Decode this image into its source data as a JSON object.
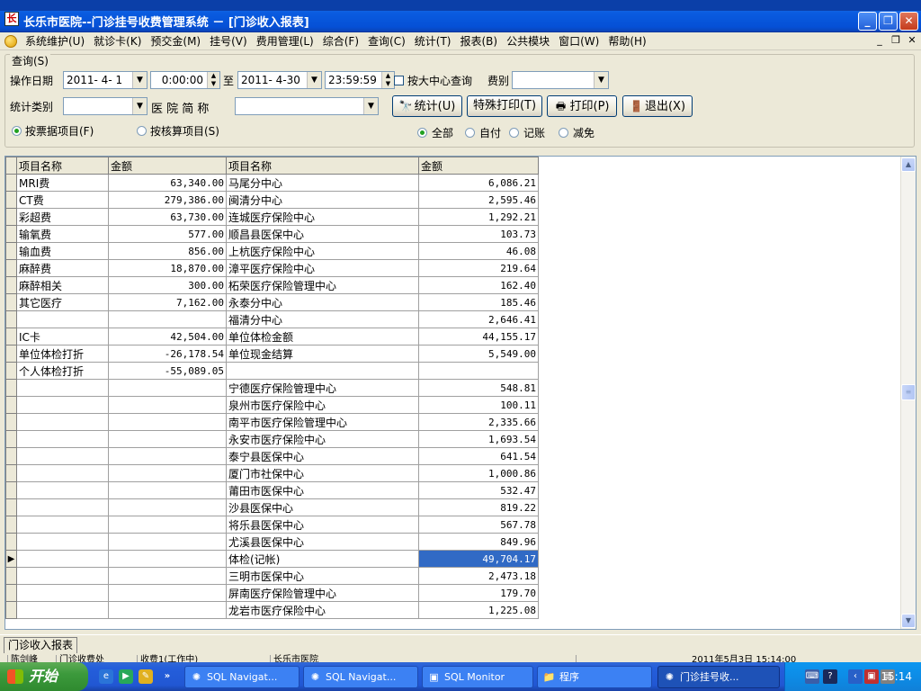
{
  "window": {
    "title": "长乐市医院--门诊挂号收费管理系统 － [门诊收入报表]",
    "app_icon": "hospital-app-icon",
    "buttons": {
      "minimize": "_",
      "restore": "❐",
      "close": "✕"
    }
  },
  "menu": [
    "系统维护(U)",
    "就诊卡(K)",
    "预交金(M)",
    "挂号(V)",
    "费用管理(L)",
    "综合(F)",
    "查询(C)",
    "统计(T)",
    "报表(B)",
    "公共模块",
    "窗口(W)",
    "帮助(H)"
  ],
  "mdi_buttons": {
    "minimize": "_",
    "restore": "❐",
    "close": "✕"
  },
  "query": {
    "group_title": "查询(S)",
    "date_label": "操作日期",
    "start_date": "2011- 4- 1",
    "start_time": "0:00:00",
    "to_label": "至",
    "end_date": "2011- 4-30",
    "end_time": "23:59:59",
    "center_checkbox_label": "按大中心查询",
    "fee_type_label": "费别",
    "fee_type_value": "",
    "stat_type_label": "统计类别",
    "stat_type_value": "",
    "hospital_label": "医 院 简 称",
    "hospital_value": "",
    "radio_invoice": "按票据项目(F)",
    "radio_accounting": "按核算项目(S)",
    "filter_all": "全部",
    "filter_self": "自付",
    "filter_account": "记账",
    "filter_waive": "减免"
  },
  "buttons": {
    "stat": "统计(U)",
    "special_print": "特殊打印(T)",
    "print": "打印(P)",
    "exit": "退出(X)"
  },
  "grid": {
    "headers": [
      "项目名称",
      "金额",
      "项目名称",
      "金额"
    ],
    "rows": [
      {
        "a": "MRI费",
        "b": "63,340.00",
        "c": "马尾分中心",
        "d": "6,086.21"
      },
      {
        "a": "CT费",
        "b": "279,386.00",
        "c": "闽清分中心",
        "d": "2,595.46"
      },
      {
        "a": "彩超费",
        "b": "63,730.00",
        "c": "连城医疗保险中心",
        "d": "1,292.21"
      },
      {
        "a": "输氧费",
        "b": "577.00",
        "c": "顺昌县医保中心",
        "d": "103.73"
      },
      {
        "a": "输血费",
        "b": "856.00",
        "c": "上杭医疗保险中心",
        "d": "46.08"
      },
      {
        "a": "麻醉费",
        "b": "18,870.00",
        "c": "漳平医疗保险中心",
        "d": "219.64"
      },
      {
        "a": "麻醉相关",
        "b": "300.00",
        "c": "柘荣医疗保险管理中心",
        "d": "162.40"
      },
      {
        "a": "其它医疗",
        "b": "7,162.00",
        "c": "永泰分中心",
        "d": "185.46"
      },
      {
        "a": "",
        "b": "",
        "c": "福清分中心",
        "d": "2,646.41"
      },
      {
        "a": "IC卡",
        "b": "42,504.00",
        "c": "单位体检金额",
        "d": "44,155.17"
      },
      {
        "a": "单位体检打折",
        "b": "-26,178.54",
        "c": "单位现金结算",
        "d": "5,549.00"
      },
      {
        "a": "个人体检打折",
        "b": "-55,089.05",
        "c": "",
        "d": ""
      },
      {
        "a": "",
        "b": "",
        "c": "宁德医疗保险管理中心",
        "d": "548.81"
      },
      {
        "a": "",
        "b": "",
        "c": "泉州市医疗保险中心",
        "d": "100.11"
      },
      {
        "a": "",
        "b": "",
        "c": "南平市医疗保险管理中心",
        "d": "2,335.66"
      },
      {
        "a": "",
        "b": "",
        "c": "永安市医疗保险中心",
        "d": "1,693.54"
      },
      {
        "a": "",
        "b": "",
        "c": "泰宁县医保中心",
        "d": "641.54"
      },
      {
        "a": "",
        "b": "",
        "c": "厦门市社保中心",
        "d": "1,000.86"
      },
      {
        "a": "",
        "b": "",
        "c": "莆田市医保中心",
        "d": "532.47"
      },
      {
        "a": "",
        "b": "",
        "c": "沙县医保中心",
        "d": "819.22"
      },
      {
        "a": "",
        "b": "",
        "c": "将乐县医保中心",
        "d": "567.78"
      },
      {
        "a": "",
        "b": "",
        "c": "尤溪县医保中心",
        "d": "849.96"
      },
      {
        "a": "",
        "b": "",
        "c": "体检(记帐)",
        "d": "49,704.17",
        "selected": true
      },
      {
        "a": "",
        "b": "",
        "c": "三明市医保中心",
        "d": "2,473.18"
      },
      {
        "a": "",
        "b": "",
        "c": "屏南医疗保险管理中心",
        "d": "179.70"
      },
      {
        "a": "",
        "b": "",
        "c": "龙岩市医疗保险中心",
        "d": "1,225.08"
      }
    ]
  },
  "tab": "门诊收入报表",
  "status": [
    "陈剑峰",
    "门诊收费处",
    "收费1(工作中)",
    "长乐市医院",
    "2011年5月3日 15:14:00"
  ],
  "taskbar": {
    "start": "开始",
    "tasks": [
      {
        "label": "SQL Navigat...",
        "icon": "sql-navigator-icon"
      },
      {
        "label": "SQL Navigat...",
        "icon": "sql-navigator-icon"
      },
      {
        "label": "SQL Monitor",
        "icon": "sql-monitor-icon"
      },
      {
        "label": "程序",
        "icon": "folder-icon"
      },
      {
        "label": "门诊挂号收...",
        "icon": "hospital-app-icon",
        "active": true
      }
    ],
    "clock": "15:14"
  }
}
